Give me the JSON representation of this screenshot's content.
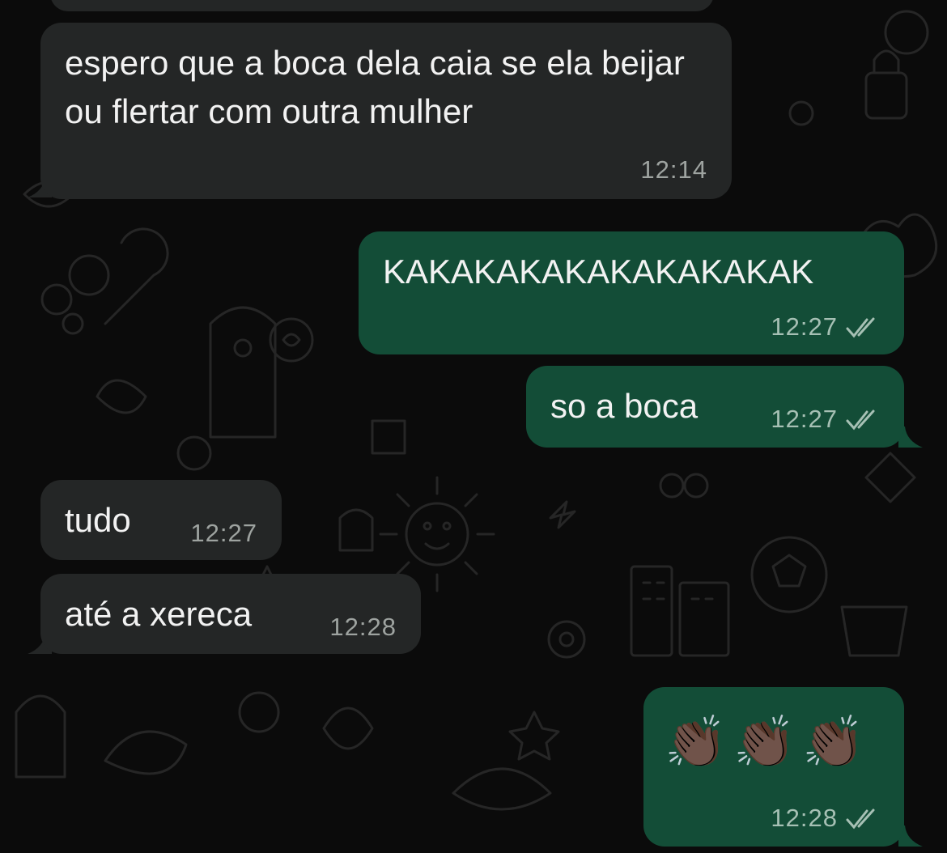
{
  "chat": {
    "messages": [
      {
        "direction": "incoming",
        "text": "espero que a boca dela caia se ela beijar ou flertar com outra mulher",
        "time": "12:14"
      },
      {
        "direction": "outgoing",
        "text": "KAKAKAKAKAKAKAKAKAK",
        "time": "12:27",
        "status": "read"
      },
      {
        "direction": "outgoing",
        "text": "so a boca",
        "time": "12:27",
        "status": "read"
      },
      {
        "direction": "incoming",
        "text": "tudo",
        "time": "12:27"
      },
      {
        "direction": "incoming",
        "text": "até a xereca",
        "time": "12:28"
      },
      {
        "direction": "outgoing",
        "text": "👏🏿👏🏿👏🏿",
        "time": "12:28",
        "status": "read"
      }
    ]
  },
  "colors": {
    "background": "#0b0b0b",
    "incoming_bubble": "#242626",
    "outgoing_bubble": "#134d37",
    "read_ticks": "#a6c0b4"
  },
  "icons": {
    "read_receipt": "double-check-icon",
    "wallpaper": "doodle-pattern"
  }
}
